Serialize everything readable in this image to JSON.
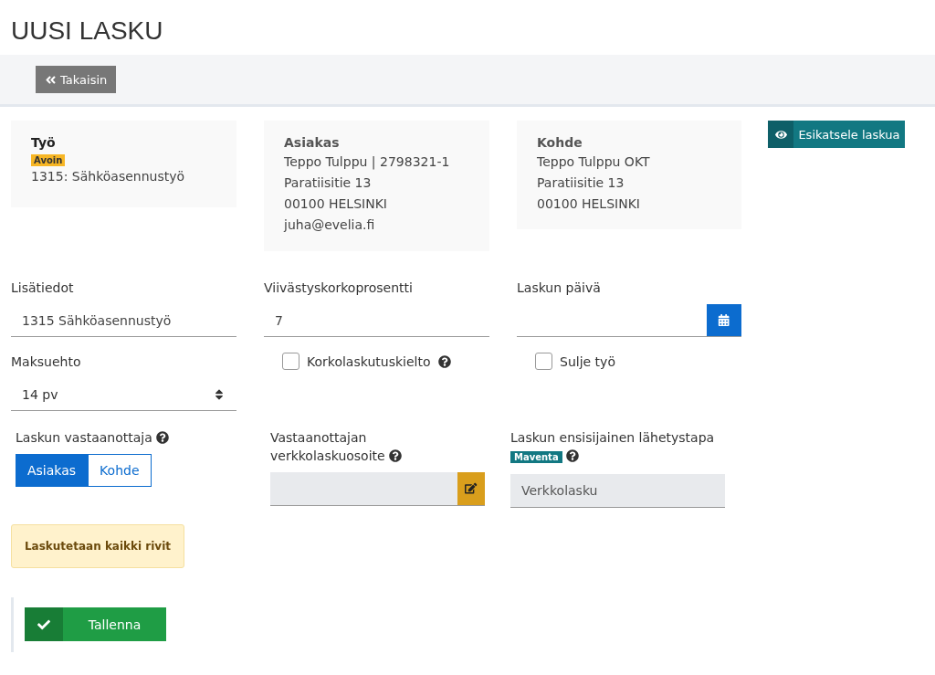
{
  "title": "UUSI LASKU",
  "toolbar": {
    "back_button": "Takaisin"
  },
  "cards": [
    {
      "heading": "Työ",
      "badge": "Avoin",
      "lines": [
        "1315: Sähköasennustyö"
      ],
      "bold_heading": true
    },
    {
      "heading": "Asiakas",
      "lines": [
        "Teppo Tulppu | 2798321-1",
        "Paratiisitie 13",
        "00100 HELSINKI",
        "juha@evelia.fi"
      ],
      "bold_heading": false
    },
    {
      "heading": "Kohde",
      "lines": [
        "Teppo Tulppu OKT",
        "Paratiisitie 13",
        "00100 HELSINKI"
      ],
      "bold_heading": false
    }
  ],
  "preview_button": "Esikatsele laskua",
  "fields": {
    "lisatiedot": {
      "label": "Lisätiedot",
      "value": "1315 Sähköasennustyö"
    },
    "viivastyskorko": {
      "label": "Viivästyskorkoprosentti",
      "value": "7"
    },
    "laskun_paiva": {
      "label": "Laskun päivä"
    },
    "maksuehto": {
      "label": "Maksuehto",
      "value": "14 pv"
    }
  },
  "checkboxes": [
    {
      "label": "Korkolaskutuskielto",
      "checked": false,
      "help": true
    },
    {
      "label": "Sulje työ",
      "checked": false,
      "help": false
    }
  ],
  "recipient": {
    "label": "Laskun vastaanottaja",
    "options": [
      {
        "label": "Asiakas",
        "selected": true
      },
      {
        "label": "Kohde",
        "selected": false
      }
    ]
  },
  "einvoice_address": {
    "label_lines": [
      "Vastaanottajan",
      "verkkolaskuosoite"
    ]
  },
  "send_method": {
    "label": "Laskun ensisijainen lähetystapa",
    "badge": "Maventa",
    "value": "Verkkolasku"
  },
  "alert": "Laskutetaan kaikki rivit",
  "save_button": "Tallenna"
}
